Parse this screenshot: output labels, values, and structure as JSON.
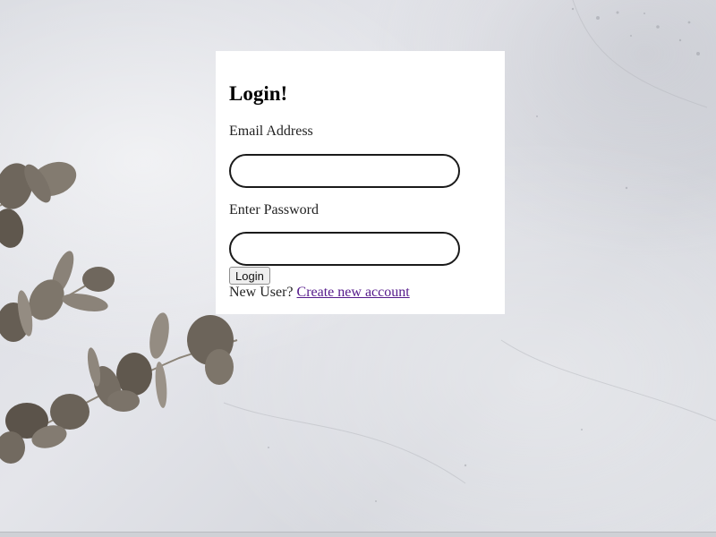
{
  "login": {
    "title": "Login!",
    "email_label": "Email Address",
    "email_value": "",
    "password_label": "Enter Password",
    "password_value": "",
    "login_button": "Login",
    "new_user_text": "New User?",
    "create_account_link": "Create new account"
  },
  "colors": {
    "card_background": "#ffffff",
    "link_visited": "#551a8b",
    "page_background": "#dcdee3"
  },
  "icons": [
    "eucalyptus-branch-decoration"
  ]
}
